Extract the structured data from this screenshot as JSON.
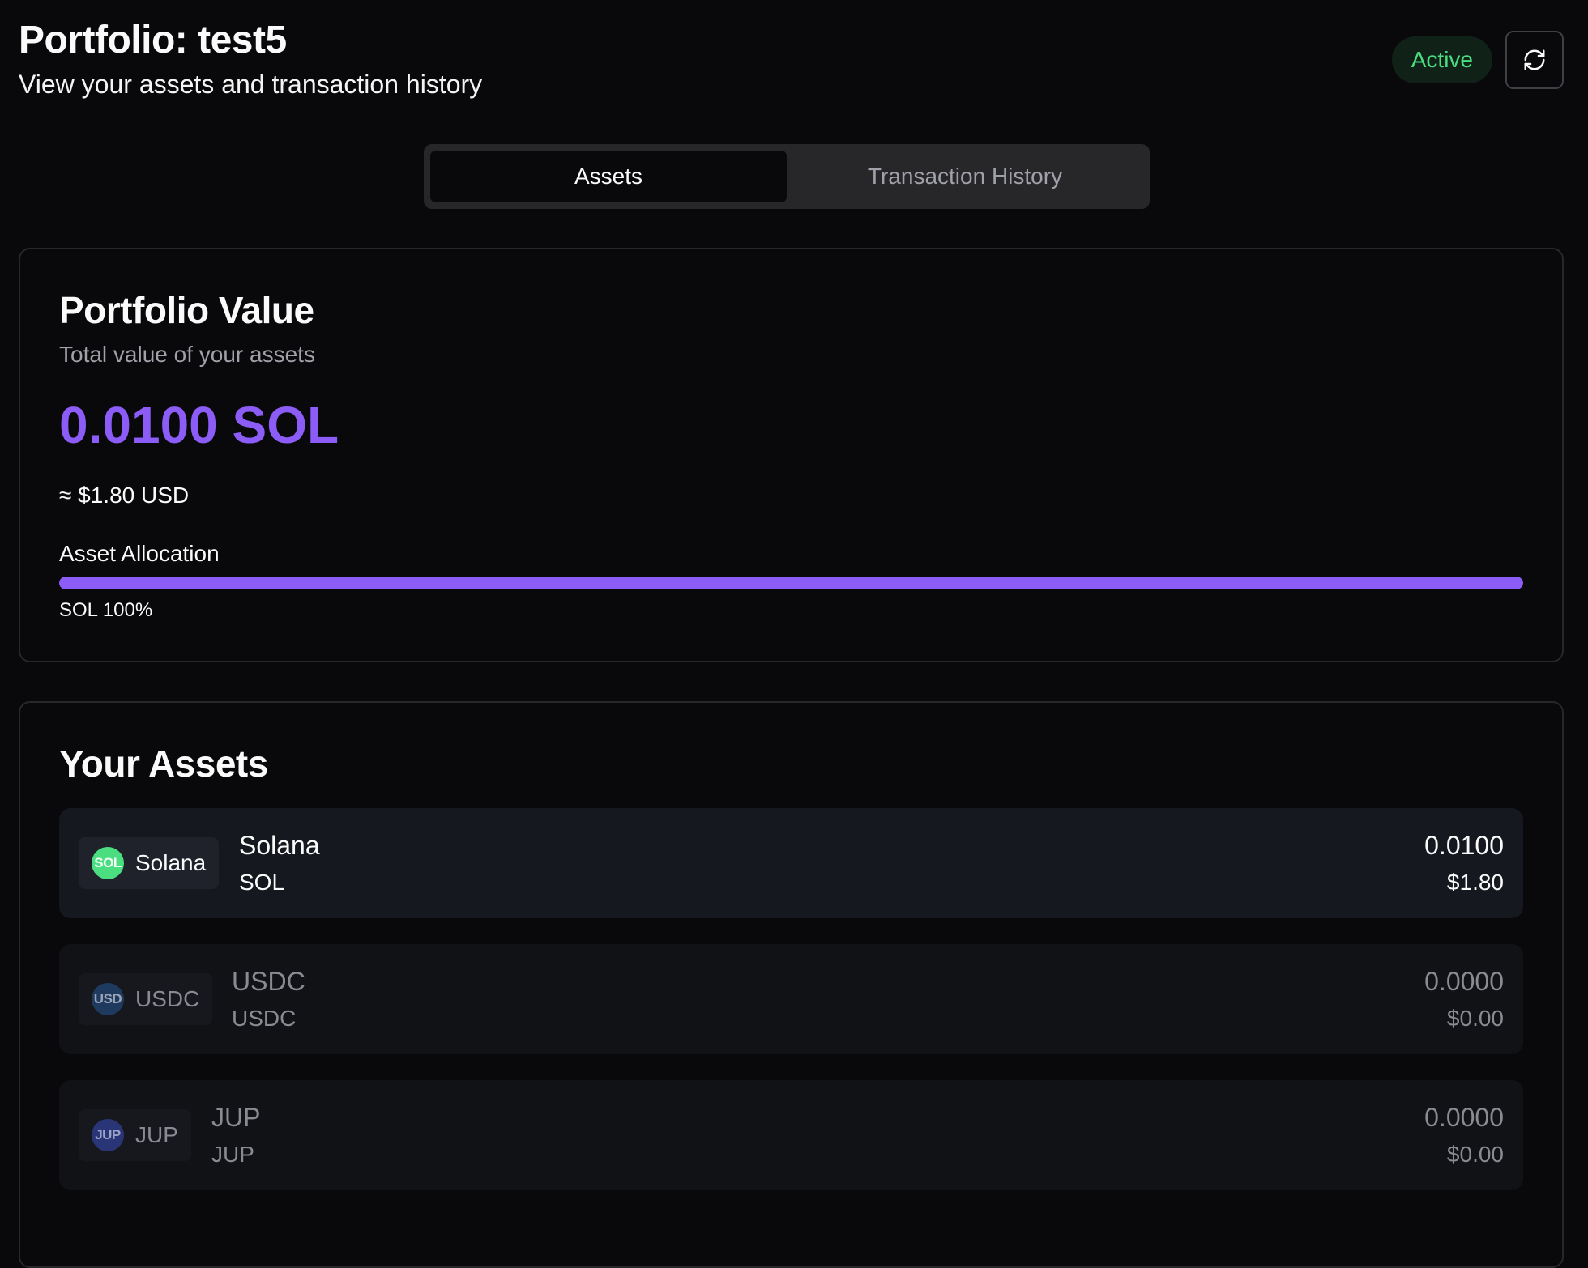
{
  "header": {
    "title": "Portfolio: test5",
    "subtitle": "View your assets and transaction history",
    "status_label": "Active",
    "refresh_icon": "refresh-icon"
  },
  "tabs": [
    {
      "label": "Assets",
      "active": true
    },
    {
      "label": "Transaction History",
      "active": false
    }
  ],
  "portfolio_value": {
    "title": "Portfolio Value",
    "description": "Total value of your assets",
    "total": "0.0100 SOL",
    "usd_approx": "≈ $1.80 USD",
    "allocation_label": "Asset Allocation",
    "allocation": [
      {
        "symbol": "SOL",
        "percent": 100,
        "label": "SOL 100%"
      }
    ]
  },
  "assets": {
    "title": "Your Assets",
    "items": [
      {
        "icon_text": "SOL",
        "pill_label": "Solana",
        "name": "Solana",
        "symbol": "SOL",
        "amount": "0.0100",
        "usd": "$1.80",
        "icon_color": "#4ade80"
      },
      {
        "icon_text": "USD",
        "pill_label": "USDC",
        "name": "USDC",
        "symbol": "USDC",
        "amount": "0.0000",
        "usd": "$0.00",
        "icon_color": "#1e3a5f"
      },
      {
        "icon_text": "JUP",
        "pill_label": "JUP",
        "name": "JUP",
        "symbol": "JUP",
        "amount": "0.0000",
        "usd": "$0.00",
        "icon_color": "#2a3577"
      }
    ]
  },
  "colors": {
    "accent": "#8b5cf6",
    "status_green": "#4ade80",
    "background": "#09090b"
  }
}
